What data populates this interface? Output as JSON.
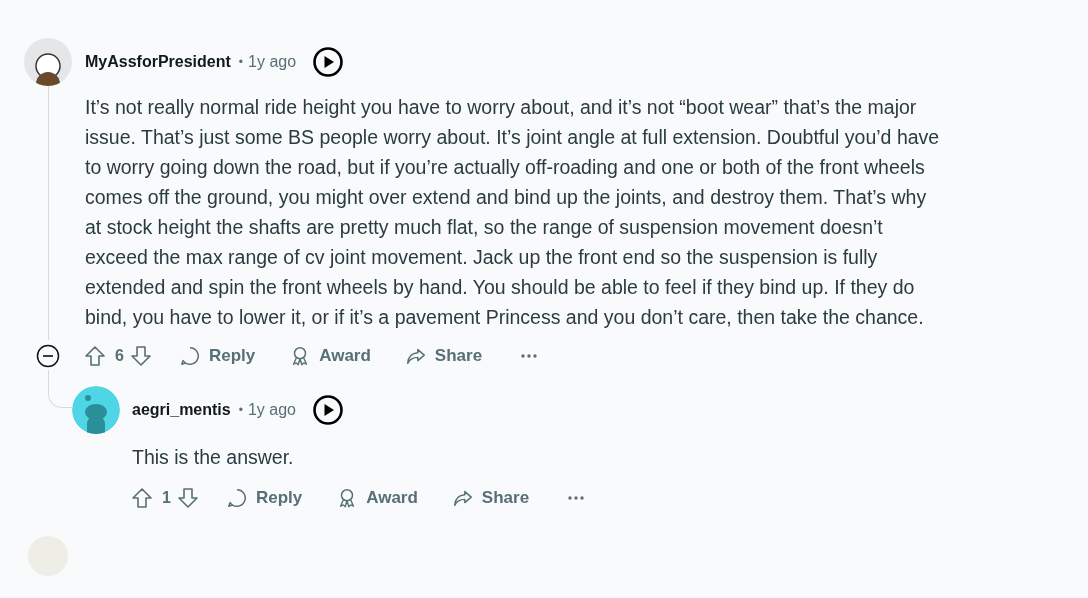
{
  "comments": [
    {
      "author": "MyAssforPresident",
      "separator": "•",
      "time": "1y ago",
      "body": "It’s not really normal ride height you have to worry about, and it’s not “boot wear” that’s the major issue. That’s just some BS people worry about. It’s joint angle at full extension. Doubtful you’d have to worry going down the road, but if you’re actually off-roading and one or both of the front wheels comes off the ground, you might over extend and bind up the joints, and destroy them. That’s why at stock height the shafts are pretty much flat, so the range of suspension movement doesn’t exceed the max range of cv joint movement. Jack up the front end so the suspension is fully extended and spin the front wheels by hand. You should be able to feel if they bind up. If they do bind, you have to lower it, or if it’s a pavement Princess and you don’t care, then take the chance.",
      "score": "6",
      "actions": [
        "Reply",
        "Award",
        "Share"
      ],
      "expanded": true,
      "replies": [
        {
          "author": "aegri_mentis",
          "separator": "•",
          "time": "1y ago",
          "body": "This is the answer.",
          "score": "1",
          "actions": [
            "Reply",
            "Award",
            "Share"
          ]
        }
      ]
    }
  ]
}
